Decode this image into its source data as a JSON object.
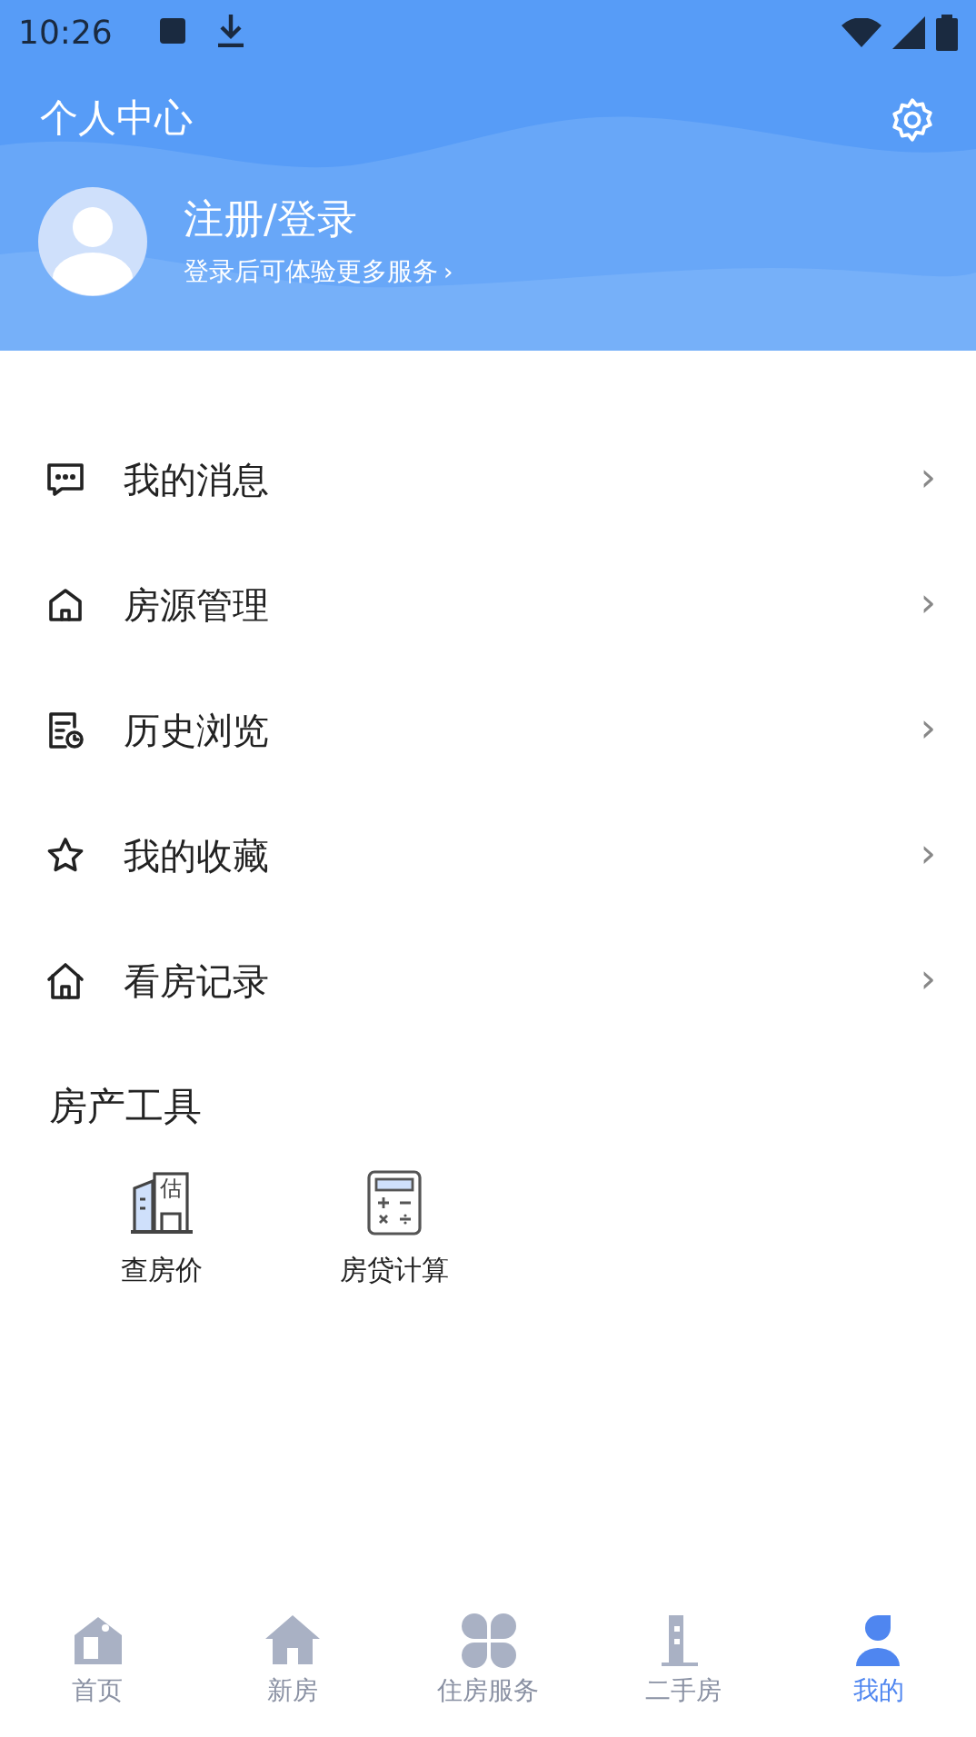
{
  "status_bar": {
    "time": "10:26"
  },
  "header": {
    "title": "个人中心",
    "user": {
      "name": "注册/登录",
      "hint": "登录后可体验更多服务",
      "arrow": "›"
    }
  },
  "menu": [
    {
      "kind": "message",
      "label": "我的消息",
      "arrow": "›"
    },
    {
      "kind": "house",
      "label": "房源管理",
      "arrow": "›"
    },
    {
      "kind": "history",
      "label": "历史浏览",
      "arrow": "›"
    },
    {
      "kind": "star",
      "label": "我的收藏",
      "arrow": "›"
    },
    {
      "kind": "home",
      "label": "看房记录",
      "arrow": "›"
    }
  ],
  "tools": {
    "title": "房产工具",
    "items": [
      {
        "kind": "price",
        "label": "查房价",
        "icon_text": "估"
      },
      {
        "kind": "calculator",
        "label": "房贷计算"
      }
    ]
  },
  "tab_bar": [
    {
      "kind": "home",
      "label": "首页",
      "selected": false
    },
    {
      "kind": "new",
      "label": "新房",
      "selected": false
    },
    {
      "kind": "service",
      "label": "住房服务",
      "selected": false
    },
    {
      "kind": "second",
      "label": "二手房",
      "selected": false
    },
    {
      "kind": "me",
      "label": "我的",
      "selected": true
    }
  ]
}
